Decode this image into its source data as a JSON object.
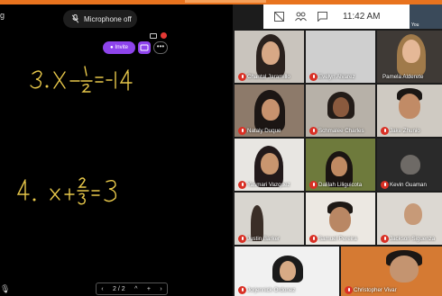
{
  "app": {
    "title_fragment": "g"
  },
  "mic_status": "Microphone off",
  "invite_label": "Invite",
  "more_label": "•••",
  "whiteboard": {
    "problem3": "3. X - 1/2 = -14",
    "problem4": "4. x + 2/3 = 3"
  },
  "pager": {
    "prev": "‹",
    "page": "2 / 2",
    "up": "^",
    "add": "+",
    "next": "›"
  },
  "status": {
    "time": "11:42 AM",
    "self_label": "You"
  },
  "colors": {
    "accent": "#8e44ec",
    "ink": "#e8c84a",
    "mute": "#d93025",
    "stripe": "#e8731e"
  },
  "participants": [
    {
      "name": "Chantal Jaramillo"
    },
    {
      "name": "Evelyn Alvarez"
    },
    {
      "name": "Pamela Alderete"
    },
    {
      "name": "Nataly Duque"
    },
    {
      "name": "Schmalee Charles"
    },
    {
      "name": "Jake Zhunio"
    },
    {
      "name": "Yasmari Vazquez"
    },
    {
      "name": "Dalilah Liliguicota"
    },
    {
      "name": "Kevin Guaman"
    },
    {
      "name": "Justin Barker"
    },
    {
      "name": "Samuel Pereira"
    },
    {
      "name": "Jackson Siguenza"
    },
    {
      "name": "Jorjennick Ordonez"
    },
    {
      "name": "Christopher Vivar"
    }
  ]
}
